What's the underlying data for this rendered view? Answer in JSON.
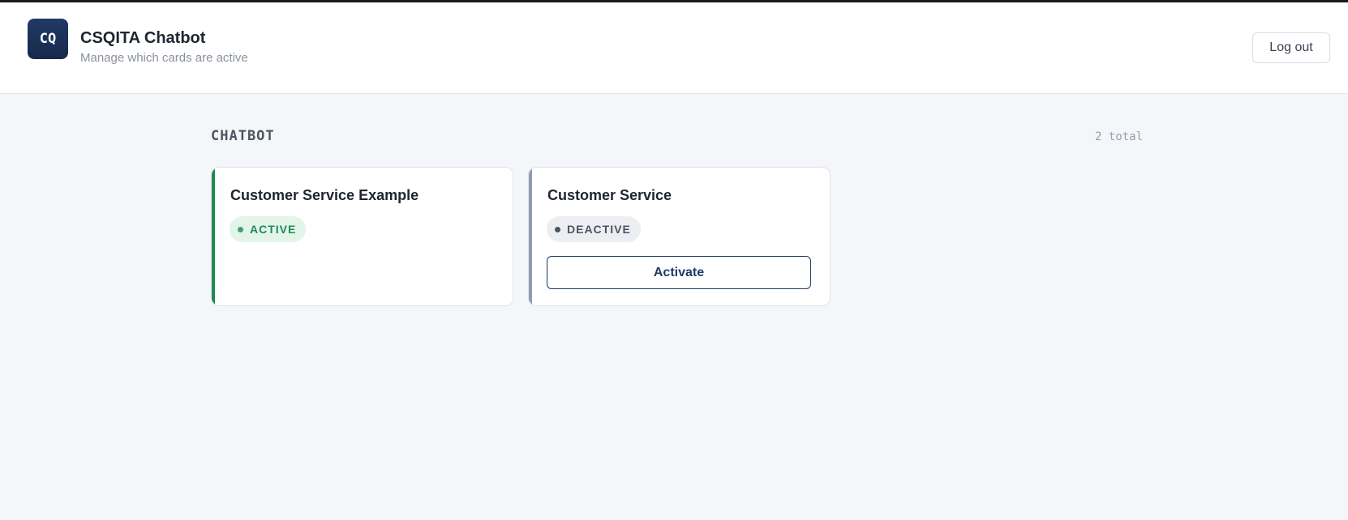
{
  "header": {
    "logo_text": "CQ",
    "title": "CSQITA Chatbot",
    "subtitle": "Manage which cards are active",
    "logout_label": "Log out"
  },
  "section": {
    "title": "CHATBOT",
    "count": "2 total"
  },
  "cards": [
    {
      "title": "Customer Service Example",
      "status": "ACTIVE",
      "accent_color": "#1f8a55"
    },
    {
      "title": "Customer Service",
      "status": "DEACTIVE",
      "accent_color": "#8f9bb3",
      "action_label": "Activate"
    }
  ],
  "colors": {
    "brand": "#1e3a66",
    "active": "#1f8a55",
    "inactive": "#4b5563",
    "background": "#f4f6fa"
  }
}
